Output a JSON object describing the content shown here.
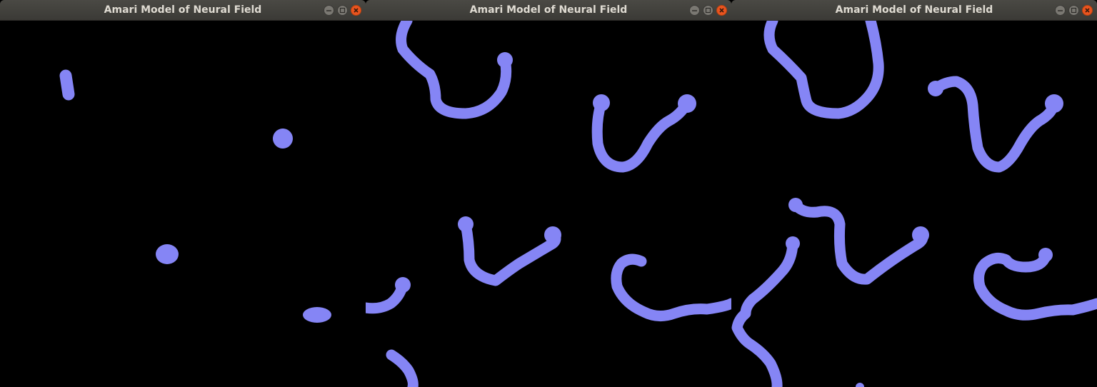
{
  "windows": [
    {
      "title": "Amari Model of Neural Field",
      "controls": {
        "minimize": "minimize-icon",
        "maximize": "maximize-icon",
        "close": "close-icon"
      }
    },
    {
      "title": "Amari Model of Neural Field",
      "controls": {
        "minimize": "minimize-icon",
        "maximize": "maximize-icon",
        "close": "close-icon"
      }
    },
    {
      "title": "Amari Model of Neural Field",
      "controls": {
        "minimize": "minimize-icon",
        "maximize": "maximize-icon",
        "close": "close-icon"
      }
    }
  ],
  "colors": {
    "background": "#000000",
    "field_activity": "#8585f5",
    "titlebar": "#3f3e3a",
    "title_text": "#dfdbd2",
    "close_button": "#e9541f"
  }
}
